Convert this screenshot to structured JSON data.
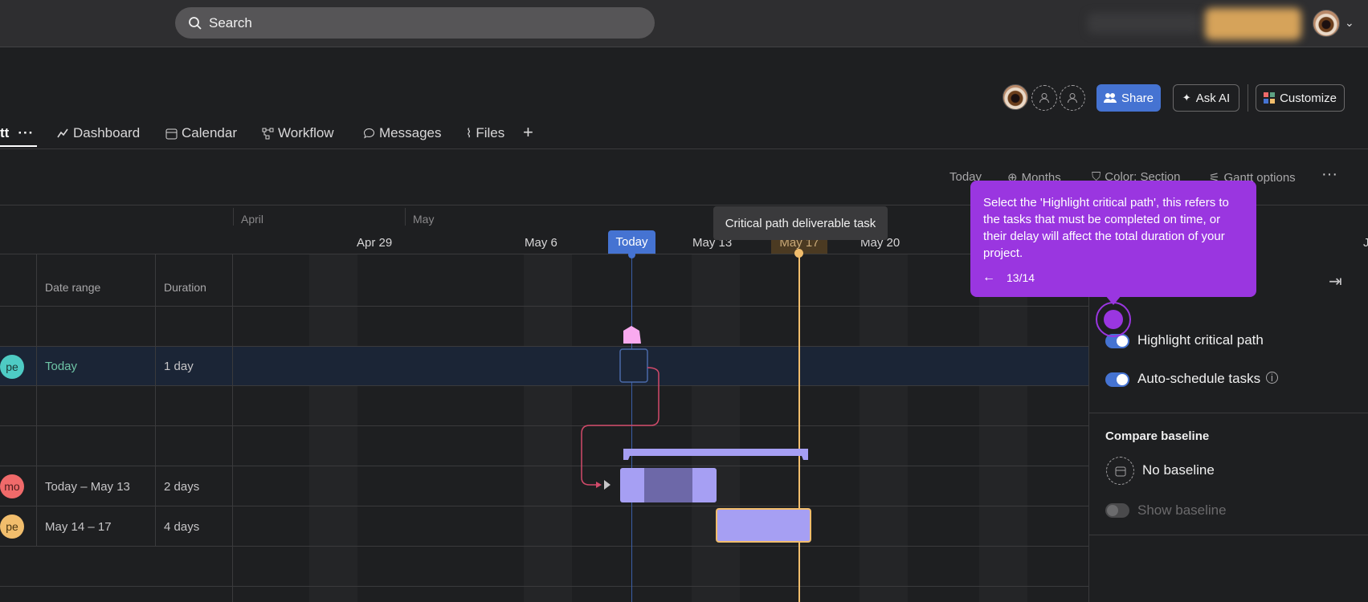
{
  "search": {
    "label": "Search"
  },
  "header": {
    "buttons": {
      "share": "Share",
      "ask_ai": "Ask AI",
      "customize": "Customize"
    }
  },
  "tabs": [
    {
      "label": "tt",
      "icon": "more-icon"
    },
    {
      "label": "Dashboard",
      "icon": "chart-icon"
    },
    {
      "label": "Calendar",
      "icon": "calendar-icon"
    },
    {
      "label": "Workflow",
      "icon": "workflow-icon"
    },
    {
      "label": "Messages",
      "icon": "message-icon"
    },
    {
      "label": "Files",
      "icon": "paperclip-icon"
    }
  ],
  "toolbar": {
    "today": "Today",
    "months": "Months",
    "color": "Color: Section",
    "gantt_options": "Gantt options"
  },
  "timeline": {
    "months": [
      "April",
      "May"
    ],
    "dates": [
      "Apr 29",
      "May 6",
      "May 13",
      "May 20",
      "J"
    ],
    "today_badge": "Today",
    "critical_date": "May 17",
    "critical_tooltip": "Critical path deliverable task"
  },
  "columns": {
    "date_range": "Date range",
    "duration": "Duration"
  },
  "rows": [
    {
      "avatar": "pe",
      "avatar_color": "#4ecbc4",
      "date_range": "Today",
      "duration": "1 day"
    },
    {
      "avatar": "mo",
      "avatar_color": "#f06a6a",
      "date_range": "Today – May 13",
      "duration": "2 days"
    },
    {
      "avatar": "pe",
      "avatar_color": "#f1bd6c",
      "date_range": "May 14 – 17",
      "duration": "4 days"
    }
  ],
  "panel": {
    "highlight_critical_path": "Highlight critical path",
    "auto_schedule": "Auto-schedule tasks",
    "compare_baseline": "Compare baseline",
    "no_baseline": "No baseline",
    "show_baseline": "Show baseline"
  },
  "coach": {
    "text": "Select the 'Highlight critical path', this refers to the tasks that must be completed on time, or their delay will affect the total duration of your project.",
    "step": "13/14"
  },
  "colors": {
    "accent": "#4573d2",
    "coach": "#9a36e0",
    "critical": "#f1bd6c",
    "bar": "#a69ff3"
  }
}
